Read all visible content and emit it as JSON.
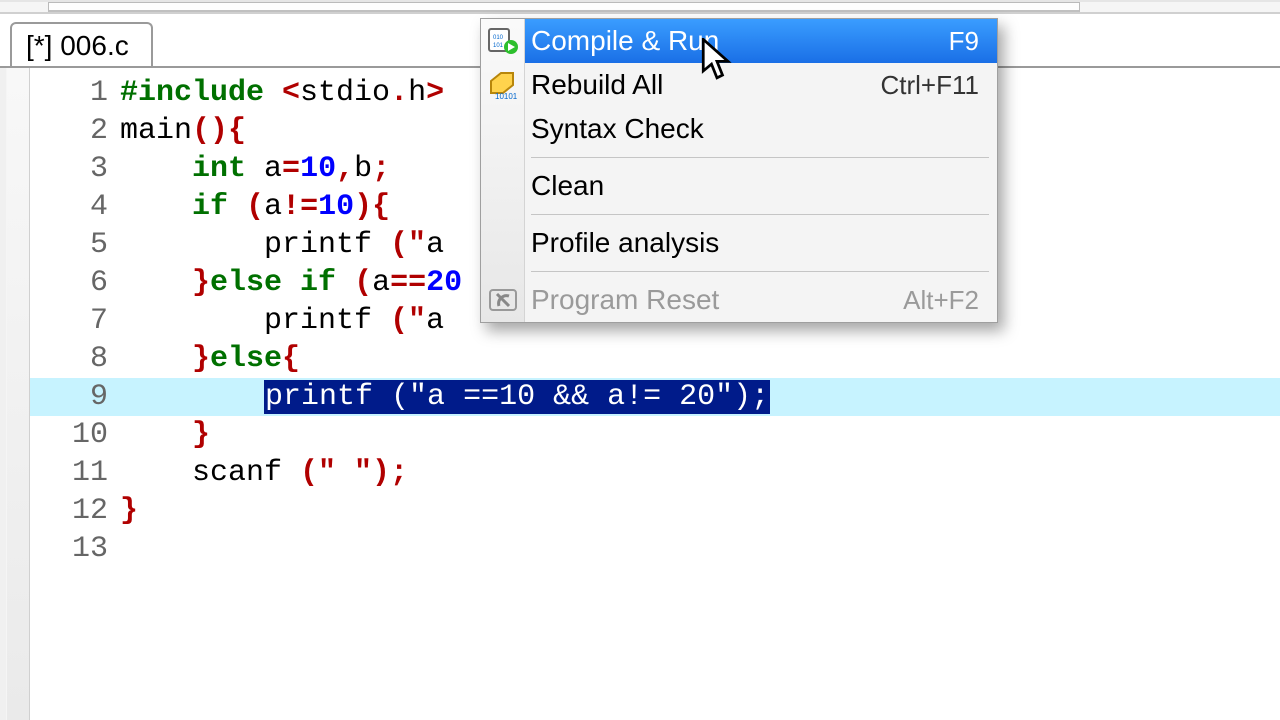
{
  "tab": {
    "label": "[*] 006.c"
  },
  "code": {
    "lines": [
      {
        "n": "1",
        "tokens": [
          {
            "c": "kw",
            "t": "#include "
          },
          {
            "c": "punc",
            "t": "<"
          },
          {
            "c": "plain",
            "t": "stdio"
          },
          {
            "c": "punc",
            "t": "."
          },
          {
            "c": "plain",
            "t": "h"
          },
          {
            "c": "punc",
            "t": ">"
          }
        ]
      },
      {
        "n": "2",
        "tokens": [
          {
            "c": "plain",
            "t": "main"
          },
          {
            "c": "punc",
            "t": "(){"
          }
        ]
      },
      {
        "n": "3",
        "tokens": [
          {
            "c": "plain",
            "t": "    "
          },
          {
            "c": "kw",
            "t": "int"
          },
          {
            "c": "plain",
            "t": " a"
          },
          {
            "c": "punc",
            "t": "="
          },
          {
            "c": "str",
            "t": "10"
          },
          {
            "c": "punc",
            "t": ","
          },
          {
            "c": "plain",
            "t": "b"
          },
          {
            "c": "punc",
            "t": ";"
          }
        ]
      },
      {
        "n": "4",
        "tokens": [
          {
            "c": "plain",
            "t": "    "
          },
          {
            "c": "kw",
            "t": "if"
          },
          {
            "c": "plain",
            "t": " "
          },
          {
            "c": "punc",
            "t": "("
          },
          {
            "c": "plain",
            "t": "a"
          },
          {
            "c": "punc",
            "t": "!="
          },
          {
            "c": "str",
            "t": "10"
          },
          {
            "c": "punc",
            "t": "){"
          }
        ]
      },
      {
        "n": "5",
        "tokens": [
          {
            "c": "plain",
            "t": "        printf "
          },
          {
            "c": "punc",
            "t": "(\""
          },
          {
            "c": "plain",
            "t": "a"
          }
        ]
      },
      {
        "n": "6",
        "tokens": [
          {
            "c": "plain",
            "t": "    "
          },
          {
            "c": "punc",
            "t": "}"
          },
          {
            "c": "kw",
            "t": "else if"
          },
          {
            "c": "plain",
            "t": " "
          },
          {
            "c": "punc",
            "t": "("
          },
          {
            "c": "plain",
            "t": "a"
          },
          {
            "c": "punc",
            "t": "=="
          },
          {
            "c": "str",
            "t": "20"
          }
        ]
      },
      {
        "n": "7",
        "tokens": [
          {
            "c": "plain",
            "t": "        printf "
          },
          {
            "c": "punc",
            "t": "(\""
          },
          {
            "c": "plain",
            "t": "a"
          }
        ]
      },
      {
        "n": "8",
        "tokens": [
          {
            "c": "plain",
            "t": "    "
          },
          {
            "c": "punc",
            "t": "}"
          },
          {
            "c": "kw",
            "t": "else"
          },
          {
            "c": "punc",
            "t": "{"
          }
        ]
      },
      {
        "n": "9",
        "tokens": [
          {
            "c": "plain",
            "t": "        "
          },
          {
            "c": "sel",
            "t": "printf (\"a ==10 && a!= 20\");"
          }
        ],
        "current": true
      },
      {
        "n": "10",
        "tokens": [
          {
            "c": "plain",
            "t": "    "
          },
          {
            "c": "punc",
            "t": "}"
          }
        ]
      },
      {
        "n": "11",
        "tokens": [
          {
            "c": "plain",
            "t": "    scanf "
          },
          {
            "c": "punc",
            "t": "(\" \");"
          }
        ]
      },
      {
        "n": "12",
        "tokens": [
          {
            "c": "punc",
            "t": "}"
          }
        ]
      },
      {
        "n": "13",
        "tokens": [
          {
            "c": "plain",
            "t": ""
          }
        ]
      }
    ]
  },
  "menu": {
    "items": [
      {
        "icon": "compile-run-icon",
        "label": "Compile & Run",
        "accel": "F9",
        "state": "highlight"
      },
      {
        "icon": "rebuild-icon",
        "label": "Rebuild All",
        "accel": "Ctrl+F11",
        "state": "normal"
      },
      {
        "icon": "",
        "label": "Syntax Check",
        "accel": "",
        "state": "normal"
      },
      {
        "sep": true
      },
      {
        "icon": "",
        "label": "Clean",
        "accel": "",
        "state": "normal"
      },
      {
        "sep": true
      },
      {
        "icon": "",
        "label": "Profile analysis",
        "accel": "",
        "state": "normal"
      },
      {
        "sep": true
      },
      {
        "icon": "reset-icon",
        "label": "Program Reset",
        "accel": "Alt+F2",
        "state": "disabled"
      }
    ]
  }
}
